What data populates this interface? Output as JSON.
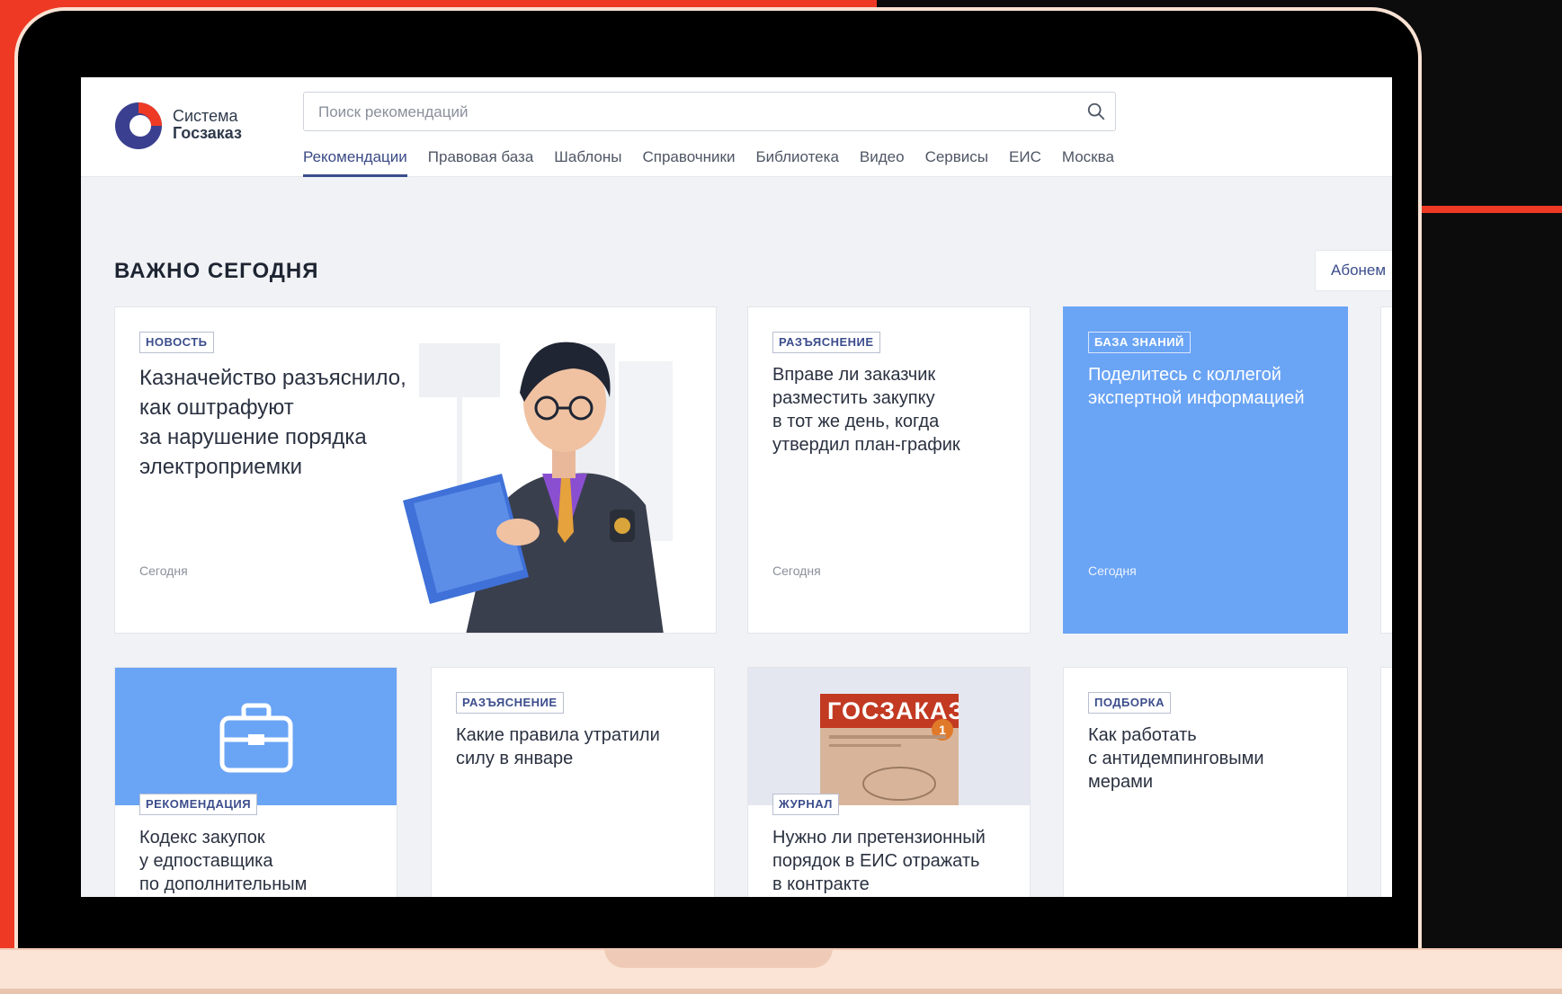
{
  "brand": {
    "line1": "Система",
    "line2": "Госзаказ"
  },
  "search": {
    "placeholder": "Поиск рекомендаций"
  },
  "nav": [
    {
      "label": "Рекомендации",
      "active": true
    },
    {
      "label": "Правовая база"
    },
    {
      "label": "Шаблоны"
    },
    {
      "label": "Справочники"
    },
    {
      "label": "Библиотека"
    },
    {
      "label": "Видео"
    },
    {
      "label": "Сервисы"
    },
    {
      "label": "ЕИС"
    },
    {
      "label": "Москва"
    }
  ],
  "section": {
    "title": "ВАЖНО СЕГОДНЯ",
    "subscribe_label": "Абонем"
  },
  "cards": [
    {
      "tag": "НОВОСТЬ",
      "title": "Казначейство разъяснило,\nкак оштрафуют\nза нарушение порядка\nэлектроприемки",
      "date": "Сегодня"
    },
    {
      "tag": "РАЗЪЯСНЕНИЕ",
      "title": "Вправе ли заказчик\nразместить закупку\nв тот же день, когда\nутвердил план-график",
      "date": "Сегодня"
    },
    {
      "tag": "БАЗА ЗНАНИЙ",
      "title": "Поделитесь с коллегой\nэкспертной информацией",
      "date": "Сегодня"
    },
    {
      "tag": "РЕКОМЕНДАЦИЯ",
      "title": "Кодекс закупок\nу едпоставщика\nпо дополнительным"
    },
    {
      "tag": "РАЗЪЯСНЕНИЕ",
      "title": "Какие правила утратили\nсилу в январе"
    },
    {
      "tag": "ЖУРНАЛ",
      "title": "Нужно ли претензионный\nпорядок в ЕИС отражать\nв контракте",
      "book_title": "ГОСЗАКАЗ",
      "book_number": "1"
    },
    {
      "tag": "ПОДБОРКА",
      "title": "Как работать\nс антидемпинговыми\nмерами"
    }
  ],
  "colors": {
    "accent": "#ee3a24",
    "brand_blue": "#3b4d8c",
    "card_blue": "#6aa4f5"
  },
  "icons": [
    "search-icon",
    "briefcase-icon",
    "brand-logo"
  ]
}
